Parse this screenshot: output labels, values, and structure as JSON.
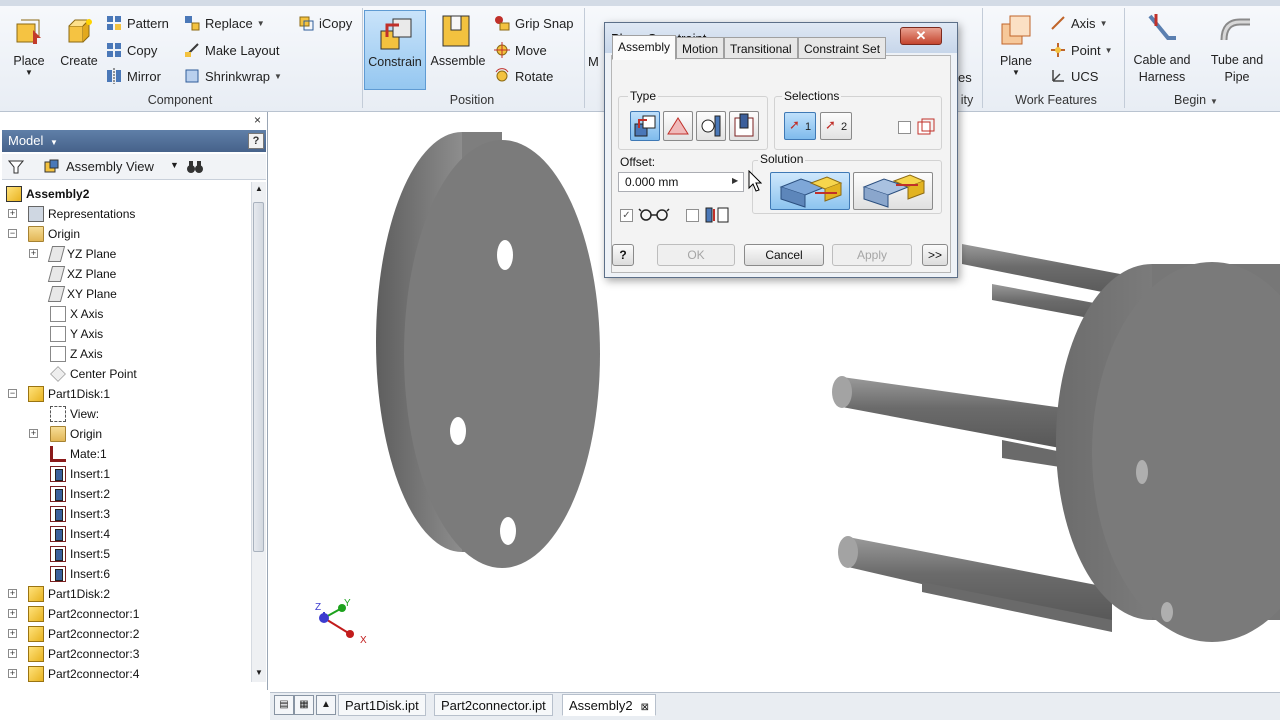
{
  "ribbon": {
    "groups": {
      "component": "Component",
      "position": "Position",
      "work_features": "Work Features",
      "begin": "Begin"
    },
    "place_label": "Place",
    "create_label": "Create",
    "pattern_label": "Pattern",
    "copy_label": "Copy",
    "mirror_label": "Mirror",
    "replace_label": "Replace",
    "make_layout_label": "Make Layout",
    "shrinkwrap_label": "Shrinkwrap",
    "icopy_label": "iCopy",
    "constrain_label": "Constrain",
    "assemble_label": "Assemble",
    "grip_snap_label": "Grip Snap",
    "move_label": "Move",
    "rotate_label": "Rotate",
    "plane_label": "Plane",
    "axis_label": "Axis",
    "point_label": "Point",
    "ucs_label": "UCS",
    "cable_harness_line1": "Cable and",
    "cable_harness_line2": "Harness",
    "tube_pipe_line1": "Tube and",
    "tube_pipe_line2": "Pipe",
    "partial_m": "M",
    "partial_es": "es",
    "partial_ity": "ity"
  },
  "browser": {
    "title": "Model",
    "view_label": "Assembly View",
    "help": "?",
    "close": "×",
    "tree": [
      {
        "label": "Assembly2",
        "bold": true
      },
      {
        "label": "Representations"
      },
      {
        "label": "Origin"
      },
      {
        "label": "YZ Plane"
      },
      {
        "label": "XZ Plane"
      },
      {
        "label": "XY Plane"
      },
      {
        "label": "X Axis"
      },
      {
        "label": "Y Axis"
      },
      {
        "label": "Z Axis"
      },
      {
        "label": "Center Point"
      },
      {
        "label": "Part1Disk:1"
      },
      {
        "label": "View:"
      },
      {
        "label": "Origin"
      },
      {
        "label": "Mate:1"
      },
      {
        "label": "Insert:1"
      },
      {
        "label": "Insert:2"
      },
      {
        "label": "Insert:3"
      },
      {
        "label": "Insert:4"
      },
      {
        "label": "Insert:5"
      },
      {
        "label": "Insert:6"
      },
      {
        "label": "Part1Disk:2"
      },
      {
        "label": "Part2connector:1"
      },
      {
        "label": "Part2connector:2"
      },
      {
        "label": "Part2connector:3"
      },
      {
        "label": "Part2connector:4"
      }
    ]
  },
  "document_tabs": [
    "Part1Disk.ipt",
    "Part2connector.ipt",
    "Assembly2"
  ],
  "dialog": {
    "title": "Place Constraint",
    "close": "✕",
    "tabs": [
      "Assembly",
      "Motion",
      "Transitional",
      "Constraint Set"
    ],
    "type_label": "Type",
    "selections_label": "Selections",
    "sel1": "1",
    "sel2": "2",
    "offset_label": "Offset:",
    "offset_value": "0.000 mm",
    "solution_label": "Solution",
    "ok_label": "OK",
    "cancel_label": "Cancel",
    "apply_label": "Apply",
    "more_label": ">>",
    "help": "?"
  },
  "triad": {
    "x": "X",
    "y": "Y",
    "z": "Z"
  },
  "colors": {
    "accent": "#3f79b5",
    "model_gray": "#7b7b7b"
  }
}
